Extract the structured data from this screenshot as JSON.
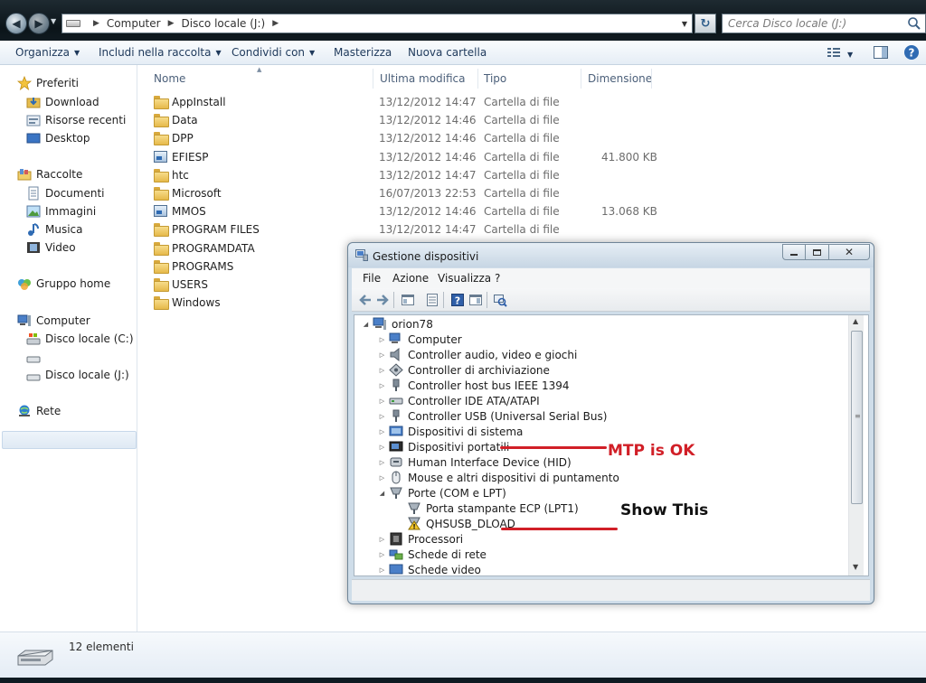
{
  "explorer": {
    "breadcrumb": [
      "Computer",
      "Disco locale (J:)"
    ],
    "search_placeholder": "Cerca Disco locale (J:)",
    "toolbar": {
      "organize": "Organizza",
      "include": "Includi nella raccolta",
      "share": "Condividi con",
      "burn": "Masterizza",
      "new_folder": "Nuova cartella"
    },
    "nav": {
      "favorites": "Preferiti",
      "download": "Download",
      "recent": "Risorse recenti",
      "desktop": "Desktop",
      "libraries": "Raccolte",
      "documents": "Documenti",
      "pictures": "Immagini",
      "music": "Musica",
      "video": "Video",
      "homegroup": "Gruppo home",
      "computer": "Computer",
      "drive_c": "Disco locale (C:)",
      "drive_j": "Disco locale (J:)",
      "network": "Rete"
    },
    "columns": {
      "name": "Nome",
      "modified": "Ultima modifica",
      "type": "Tipo",
      "size": "Dimensione"
    },
    "files": [
      {
        "name": "AppInstall",
        "date": "13/12/2012 14:47",
        "type": "Cartella di file",
        "size": "",
        "icon": "folder"
      },
      {
        "name": "Data",
        "date": "13/12/2012 14:46",
        "type": "Cartella di file",
        "size": "",
        "icon": "folder"
      },
      {
        "name": "DPP",
        "date": "13/12/2012 14:46",
        "type": "Cartella di file",
        "size": "",
        "icon": "folder"
      },
      {
        "name": "EFIESP",
        "date": "13/12/2012 14:46",
        "type": "Cartella di file",
        "size": "41.800 KB",
        "icon": "file"
      },
      {
        "name": "htc",
        "date": "13/12/2012 14:47",
        "type": "Cartella di file",
        "size": "",
        "icon": "folder"
      },
      {
        "name": "Microsoft",
        "date": "16/07/2013 22:53",
        "type": "Cartella di file",
        "size": "",
        "icon": "folder"
      },
      {
        "name": "MMOS",
        "date": "13/12/2012 14:46",
        "type": "Cartella di file",
        "size": "13.068 KB",
        "icon": "file"
      },
      {
        "name": "PROGRAM FILES",
        "date": "13/12/2012 14:47",
        "type": "Cartella di file",
        "size": "",
        "icon": "folder"
      },
      {
        "name": "PROGRAMDATA",
        "date": "",
        "type": "",
        "size": "",
        "icon": "folder"
      },
      {
        "name": "PROGRAMS",
        "date": "",
        "type": "",
        "size": "",
        "icon": "folder"
      },
      {
        "name": "USERS",
        "date": "",
        "type": "",
        "size": "",
        "icon": "folder"
      },
      {
        "name": "Windows",
        "date": "",
        "type": "",
        "size": "",
        "icon": "folder"
      }
    ],
    "status": "12 elementi"
  },
  "devmgr": {
    "title": "Gestione dispositivi",
    "menu": {
      "file": "File",
      "action": "Azione",
      "view": "Visualizza",
      "help": "?"
    },
    "tree": {
      "root": "orion78",
      "computer": "Computer",
      "audio": "Controller audio, video e giochi",
      "storage": "Controller di archiviazione",
      "ieee1394": "Controller host bus IEEE 1394",
      "ide": "Controller IDE ATA/ATAPI",
      "usb": "Controller USB (Universal Serial Bus)",
      "system": "Dispositivi di sistema",
      "portable": "Dispositivi portatili",
      "hid": "Human Interface Device (HID)",
      "mouse": "Mouse e altri dispositivi di puntamento",
      "ports": "Porte (COM e LPT)",
      "lpt1": "Porta stampante ECP (LPT1)",
      "qhsusb": "QHSUSB_DLOAD",
      "processors": "Processori",
      "network": "Schede di rete",
      "video": "Schede video"
    }
  },
  "annotations": {
    "mtp": "MTP is OK",
    "show": "Show This",
    "mtp_color": "#d11f27",
    "show_color": "#111111"
  }
}
